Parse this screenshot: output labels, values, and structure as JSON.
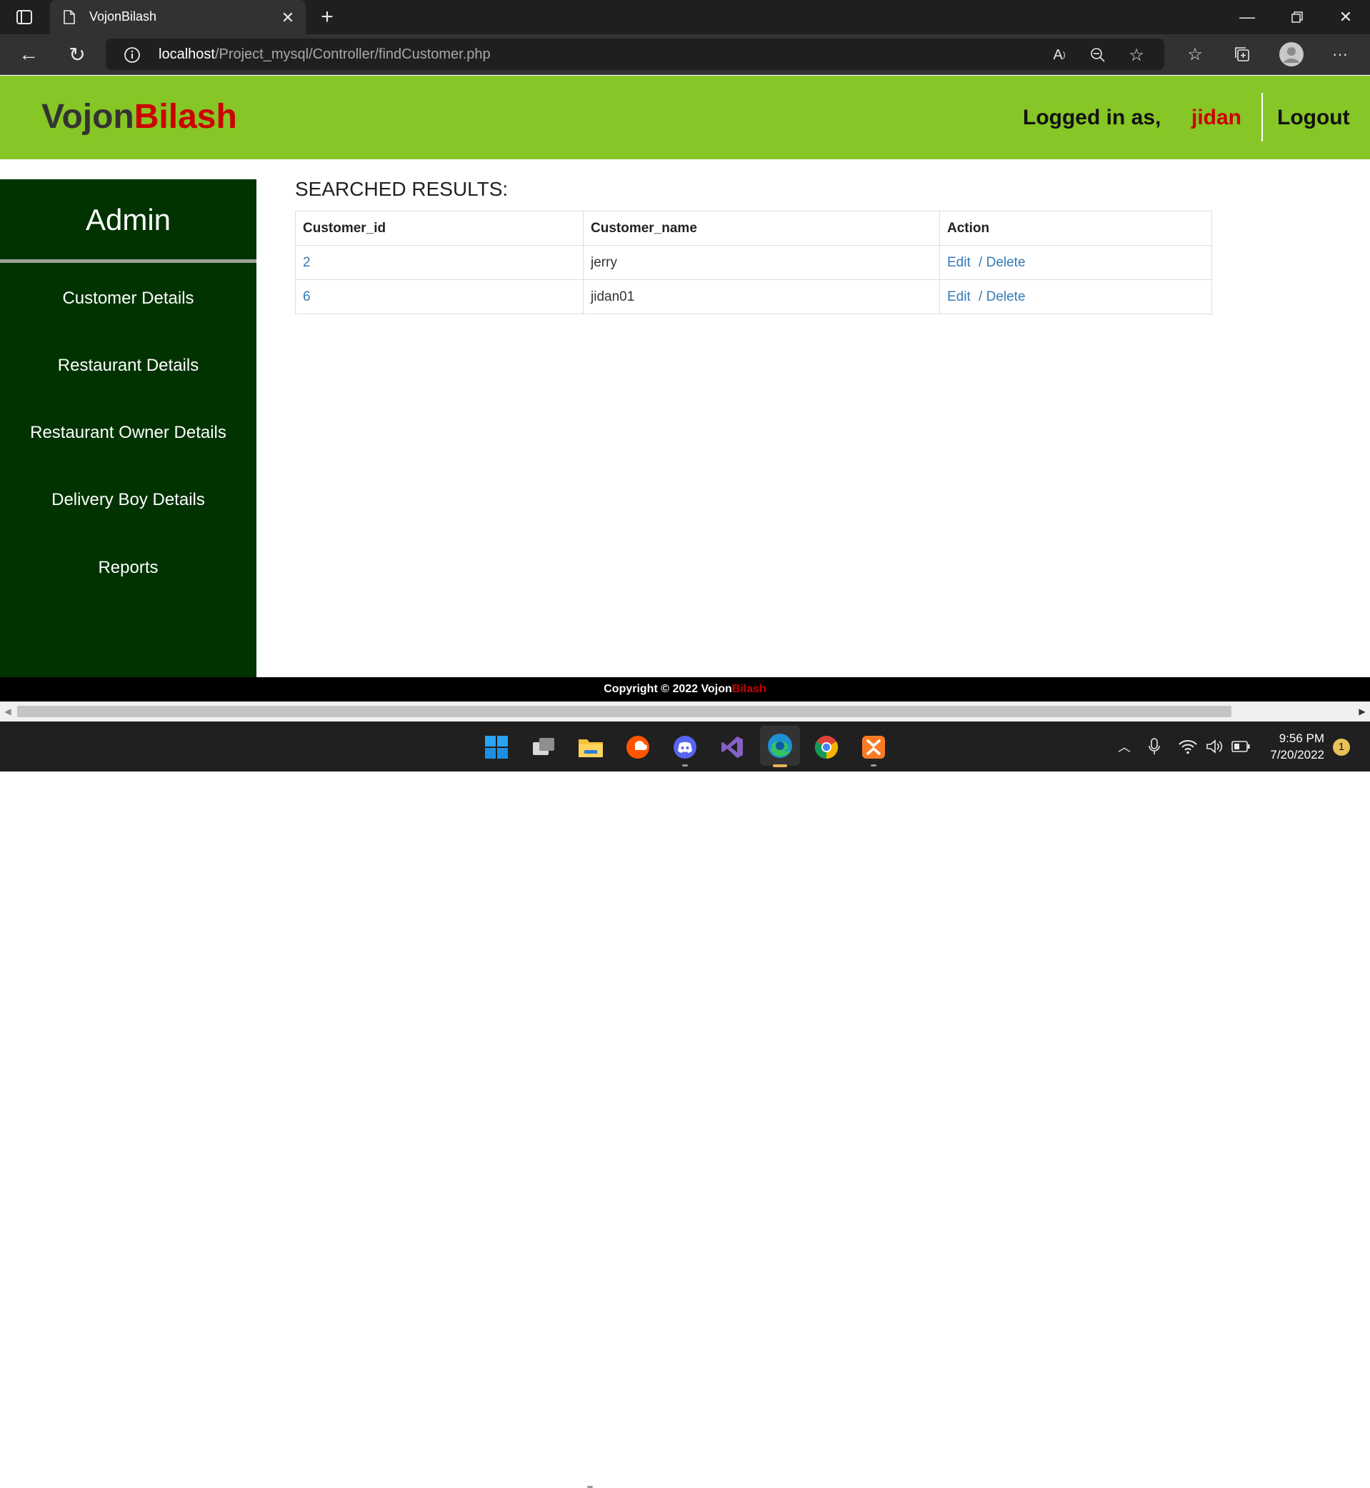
{
  "browser": {
    "tab_title": "VojonBilash",
    "url_host": "localhost",
    "url_path": "/Project_mysql/Controller/findCustomer.php"
  },
  "brand": {
    "part1": "Vojon",
    "part2": "Bilash"
  },
  "header": {
    "logged_in_label": "Logged in as,",
    "username": "jidan",
    "logout_label": "Logout"
  },
  "sidebar": {
    "title": "Admin",
    "items": [
      {
        "label": "Customer Details"
      },
      {
        "label": "Restaurant Details"
      },
      {
        "label": "Restaurant Owner Details"
      },
      {
        "label": "Delivery Boy Details"
      },
      {
        "label": "Reports"
      }
    ]
  },
  "main": {
    "heading": "SEARCHED RESULTS:",
    "columns": [
      "Customer_id",
      "Customer_name",
      "Action"
    ],
    "rows": [
      {
        "id": "2",
        "name": "jerry",
        "edit": "Edit",
        "sep": "/",
        "delete": "Delete"
      },
      {
        "id": "6",
        "name": "jidan01",
        "edit": "Edit",
        "sep": "/",
        "delete": "Delete"
      }
    ]
  },
  "footer": {
    "prefix": "Copyright © 2022 ",
    "brand1": "Vojon",
    "brand2": "Bilash"
  },
  "taskbar": {
    "time": "9:56 PM",
    "date": "7/20/2022",
    "notification_count": "1"
  },
  "colors": {
    "header_green": "#86c626",
    "sidebar_dark": "#003300",
    "brand_red": "#cc0000",
    "link_blue": "#337ab7"
  }
}
